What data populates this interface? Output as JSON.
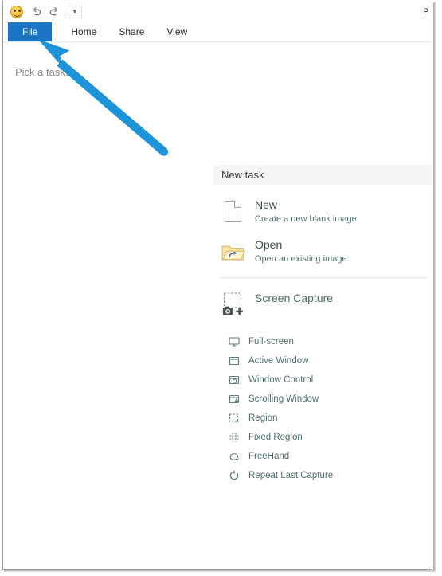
{
  "window": {
    "title_right_partial": "P",
    "quick_access": {
      "logo_icon": "sharex-smiley-logo-icon",
      "undo_icon": "undo-arrow-icon",
      "redo_icon": "redo-arrow-icon",
      "more_icon": "customize-quick-access-toolbar-icon",
      "more_glyph": "▼"
    }
  },
  "ribbon": {
    "tabs": [
      {
        "label": "File",
        "active": true
      },
      {
        "label": "Home",
        "active": false
      },
      {
        "label": "Share",
        "active": false
      },
      {
        "label": "View",
        "active": false
      }
    ],
    "active_tab_bg": "#1d74c4",
    "active_tab_fg": "#ffffff"
  },
  "backstage": {
    "hint": "Pick a task..."
  },
  "task_panel": {
    "header": "New task",
    "header_bg": "#f4f5f6",
    "primary_items": [
      {
        "title": "New",
        "subtitle": "Create a new blank image",
        "icon": "blank-document-icon"
      },
      {
        "title": "Open",
        "subtitle": "Open an existing image",
        "icon": "open-folder-icon"
      }
    ],
    "capture_group": {
      "title": "Screen Capture",
      "icon": "screen-capture-camera-icon",
      "items": [
        {
          "label": "Full-screen",
          "icon": "monitor-icon"
        },
        {
          "label": "Active Window",
          "icon": "window-icon"
        },
        {
          "label": "Window Control",
          "icon": "window-search-icon"
        },
        {
          "label": "Scrolling Window",
          "icon": "window-scroll-down-icon"
        },
        {
          "label": "Region",
          "icon": "dashed-region-plus-icon"
        },
        {
          "label": "Fixed Region",
          "icon": "grid-fixed-region-icon"
        },
        {
          "label": "FreeHand",
          "icon": "freehand-lasso-icon"
        },
        {
          "label": "Repeat Last Capture",
          "icon": "repeat-refresh-icon"
        }
      ]
    },
    "colors": {
      "title_text": "#3f4a4a",
      "subtitle_text": "#51716e",
      "link_text": "#4e6e6c"
    }
  },
  "annotation": {
    "arrow_icon": "blue-pointer-arrow-icon",
    "arrow_color": "#1d93d8",
    "points_to": "File"
  }
}
